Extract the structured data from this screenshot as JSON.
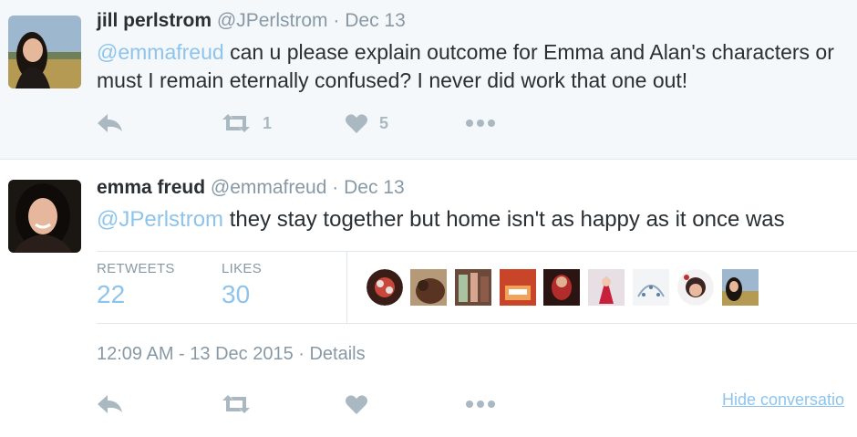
{
  "tweets": [
    {
      "name": "jill perlstrom",
      "handle": "@JPerlstrom",
      "separator": "·",
      "date": "Dec 13",
      "mention": "@emmafreud",
      "text_after_mention": " can u please explain outcome for Emma and Alan's characters or",
      "text_line2": "must I remain eternally confused? I never did work that one out!",
      "retweet_count": "1",
      "like_count": "5"
    },
    {
      "name": "emma freud",
      "handle": "@emmafreud",
      "separator": "·",
      "date": "Dec 13",
      "mention": "@JPerlstrom",
      "text_after_mention": " they stay together but home isn't as happy as it once was",
      "stats": {
        "retweets_label": "RETWEETS",
        "retweets_value": "22",
        "likes_label": "LIKES",
        "likes_value": "30"
      },
      "timestamp": "12:09 AM - 13 Dec 2015 · Details",
      "hide_conversation": "Hide conversatio"
    }
  ],
  "icons": {
    "reply": "reply-icon",
    "retweet": "retweet-icon",
    "like": "heart-icon",
    "more": "more-dots-icon"
  },
  "colors": {
    "link_blue": "#8ec4ec",
    "muted_gray": "#8899a6",
    "icon_gray": "#aab8c2",
    "expanded_bg": "#f5f8fa"
  }
}
